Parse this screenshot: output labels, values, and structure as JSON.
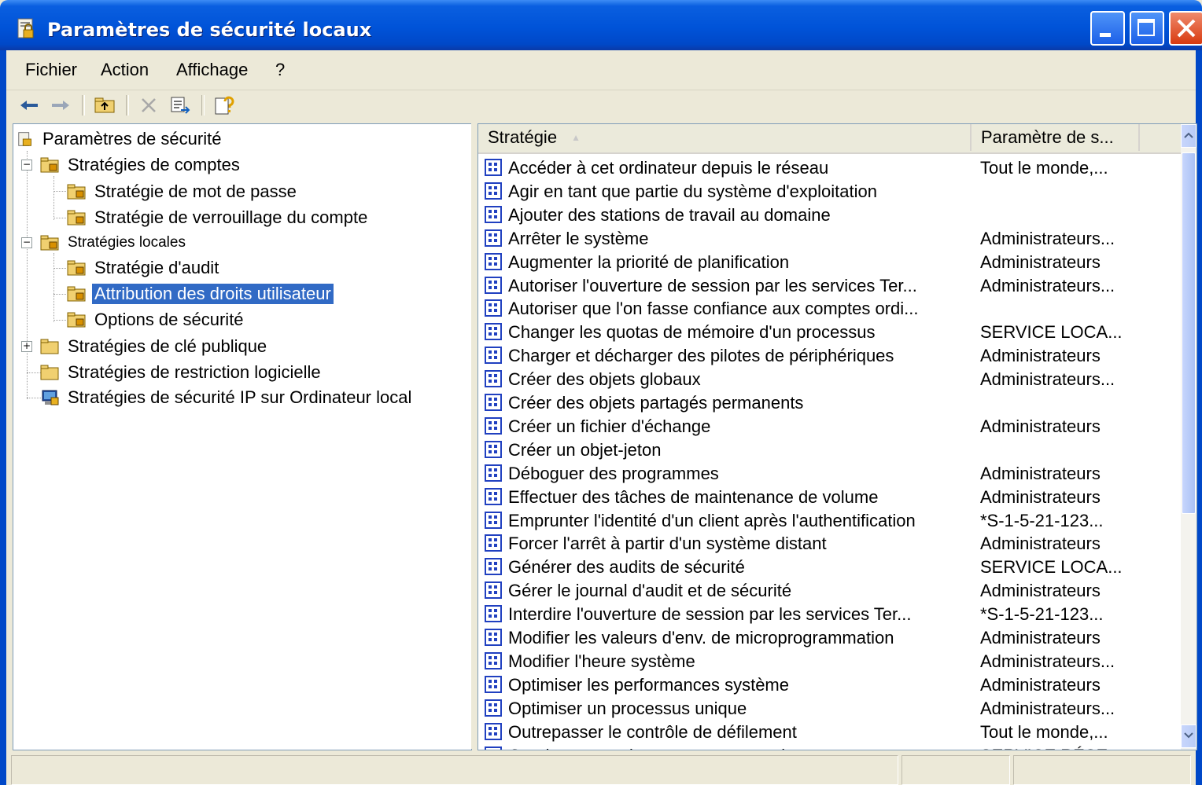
{
  "window": {
    "title": "Paramètres de sécurité locaux"
  },
  "menu": {
    "items": [
      "Fichier",
      "Action",
      "Affichage",
      "?"
    ]
  },
  "toolbar": {
    "icons": [
      "back-arrow-icon",
      "forward-arrow-icon",
      "up-folder-icon",
      "delete-icon",
      "export-list-icon",
      "help-icon"
    ]
  },
  "tree": {
    "root": "Paramètres de sécurité",
    "items": [
      {
        "label": "Stratégies de comptes"
      },
      {
        "label": "Stratégie de mot de passe"
      },
      {
        "label": "Stratégie de verrouillage du compte"
      },
      {
        "label": "Stratégies locales"
      },
      {
        "label": "Stratégie d'audit"
      },
      {
        "label": "Attribution des droits utilisateur"
      },
      {
        "label": "Options de sécurité"
      },
      {
        "label": "Stratégies de clé publique"
      },
      {
        "label": "Stratégies de restriction logicielle"
      },
      {
        "label": "Stratégies de sécurité IP sur Ordinateur local"
      }
    ],
    "selected": "Attribution des droits utilisateur"
  },
  "list": {
    "columns": [
      "Stratégie",
      "Paramètre de s..."
    ],
    "sort_indicator": "▲",
    "rows": [
      {
        "policy": "Accéder à cet ordinateur depuis le réseau",
        "setting": "Tout le monde,..."
      },
      {
        "policy": "Agir en tant que partie du système d'exploitation",
        "setting": ""
      },
      {
        "policy": "Ajouter des stations de travail au domaine",
        "setting": ""
      },
      {
        "policy": "Arrêter le système",
        "setting": "Administrateurs..."
      },
      {
        "policy": "Augmenter la priorité de planification",
        "setting": "Administrateurs"
      },
      {
        "policy": "Autoriser l'ouverture de session par les services Ter...",
        "setting": "Administrateurs..."
      },
      {
        "policy": "Autoriser que l'on fasse confiance aux comptes ordi...",
        "setting": ""
      },
      {
        "policy": "Changer les quotas de mémoire d'un processus",
        "setting": "SERVICE LOCA..."
      },
      {
        "policy": "Charger et décharger des pilotes de périphériques",
        "setting": "Administrateurs"
      },
      {
        "policy": "Créer des objets globaux",
        "setting": "Administrateurs..."
      },
      {
        "policy": "Créer des objets partagés permanents",
        "setting": ""
      },
      {
        "policy": "Créer un fichier d'échange",
        "setting": "Administrateurs"
      },
      {
        "policy": "Créer un objet-jeton",
        "setting": ""
      },
      {
        "policy": "Déboguer des programmes",
        "setting": "Administrateurs"
      },
      {
        "policy": "Effectuer des tâches de maintenance de volume",
        "setting": "Administrateurs"
      },
      {
        "policy": "Emprunter l'identité d'un client après l'authentification",
        "setting": "*S-1-5-21-123..."
      },
      {
        "policy": "Forcer l'arrêt à partir d'un système distant",
        "setting": "Administrateurs"
      },
      {
        "policy": "Générer des audits de sécurité",
        "setting": "SERVICE LOCA..."
      },
      {
        "policy": "Gérer le journal d'audit et de sécurité",
        "setting": "Administrateurs"
      },
      {
        "policy": "Interdire l'ouverture de session par les services Ter...",
        "setting": "*S-1-5-21-123..."
      },
      {
        "policy": "Modifier les valeurs d'env. de microprogrammation",
        "setting": "Administrateurs"
      },
      {
        "policy": "Modifier l'heure système",
        "setting": "Administrateurs..."
      },
      {
        "policy": "Optimiser les performances système",
        "setting": "Administrateurs"
      },
      {
        "policy": "Optimiser un processus unique",
        "setting": "Administrateurs..."
      },
      {
        "policy": "Outrepasser le contrôle de défilement",
        "setting": "Tout le monde,..."
      },
      {
        "policy": "Ouvrir une session en tant que service",
        "setting": "SERVICE RÉSE..."
      }
    ]
  },
  "colors": {
    "titlebar": "#0053d8",
    "selection": "#316ac5",
    "policy_icon": "#2040c0"
  }
}
